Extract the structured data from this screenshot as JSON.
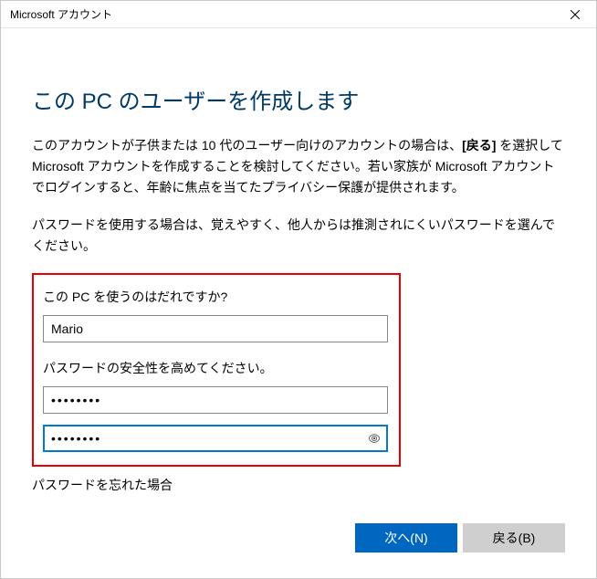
{
  "titlebar": {
    "title": "Microsoft アカウント"
  },
  "heading": "この PC のユーザーを作成します",
  "intro_prefix": "このアカウントが子供または 10 代のユーザー向けのアカウントの場合は、",
  "intro_bold": "[戻る]",
  "intro_suffix": " を選択して Microsoft アカウントを作成することを検討してください。若い家族が Microsoft アカウントでログインすると、年齢に焦点を当てたプライバシー保護が提供されます。",
  "password_hint": "パスワードを使用する場合は、覚えやすく、他人からは推測されにくいパスワードを選んでください。",
  "form": {
    "username_label": "この PC を使うのはだれですか?",
    "username_value": "Mario",
    "password_label": "パスワードの安全性を高めてください。",
    "password_value": "••••••••",
    "password_confirm_value": "••••••••"
  },
  "forgot_label": "パスワードを忘れた場合",
  "buttons": {
    "next": "次へ(N)",
    "back": "戻る(B)"
  }
}
